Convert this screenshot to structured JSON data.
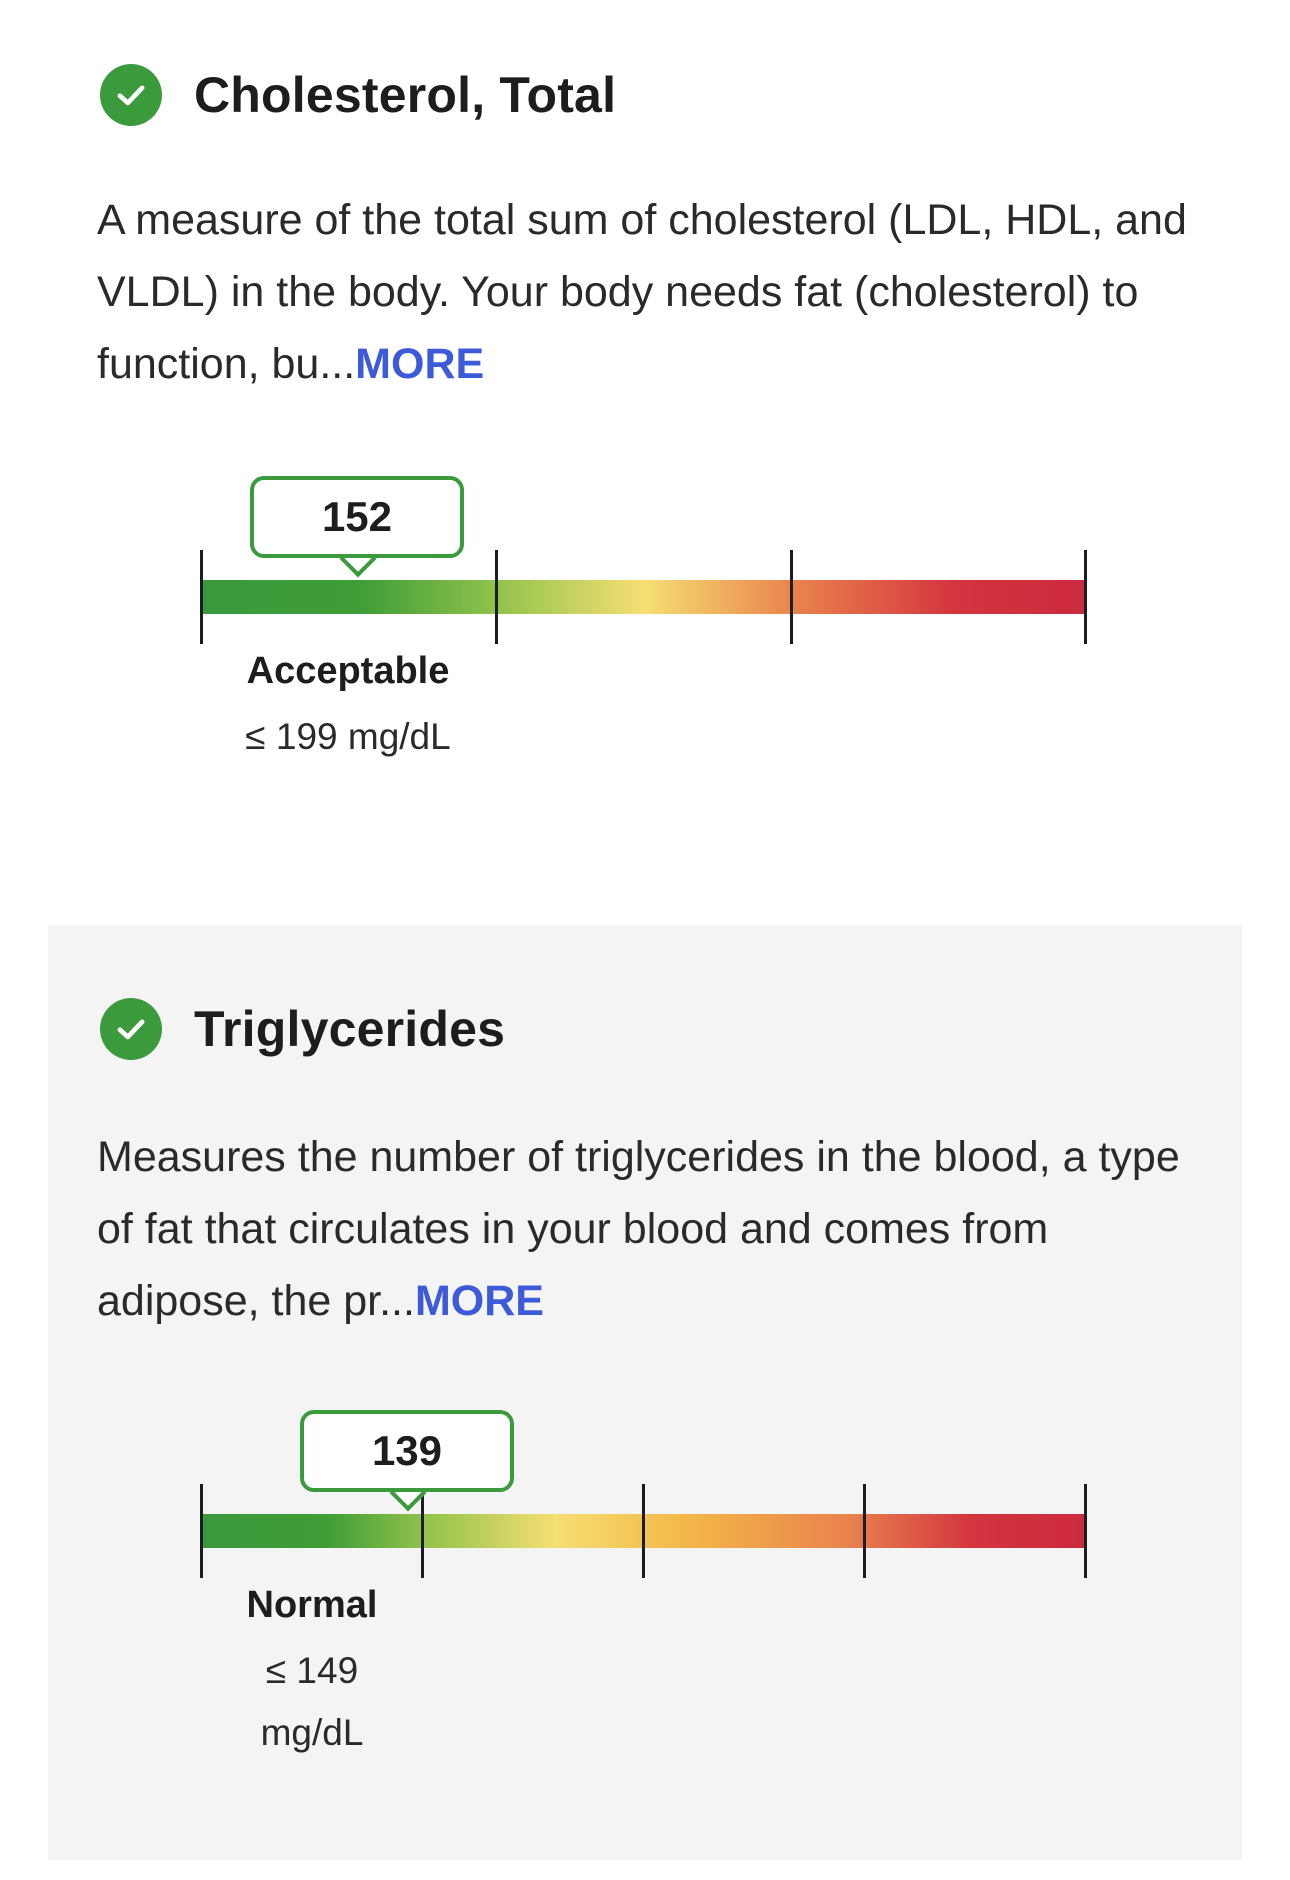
{
  "sections": [
    {
      "title": "Cholesterol, Total",
      "description": "A measure of the total sum of cholesterol (LDL, HDL, and VLDL) in the body. Your body needs fat (cholesterol) to function, bu...",
      "more_label": "MORE",
      "result_value": "152",
      "range_label": "Acceptable",
      "range_value": "≤ 199 mg/dL",
      "status_color": "#3a9a3c",
      "gauge_position_fraction": 0.17
    },
    {
      "title": "Triglycerides",
      "description": "Measures the number of triglycerides in the blood, a type of fat that circulates in your blood and comes from adipose, the pr...",
      "more_label": "MORE",
      "result_value": "139",
      "range_label": "Normal",
      "range_value_line1": "≤ 149",
      "range_value_line2": "mg/dL",
      "status_color": "#3a9a3c",
      "gauge_position_fraction": 0.23
    }
  ],
  "colors": {
    "accent_link": "#3d5bd9",
    "good": "#3a9a3c",
    "warning": "#f4d96a",
    "bad": "#cc2a3e",
    "section_background": "#f4f4f4"
  }
}
